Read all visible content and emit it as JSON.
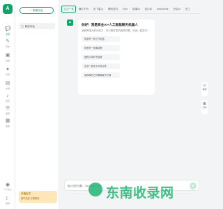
{
  "brand": {
    "logo_text": "A"
  },
  "rail": {
    "items": [
      {
        "icon": "chat-icon",
        "glyph": "💬",
        "label": "对话"
      },
      {
        "icon": "pen-icon",
        "glyph": "✎",
        "label": "写作"
      },
      {
        "icon": "image-icon",
        "glyph": "▣",
        "label": "绘画"
      },
      {
        "icon": "bulb-icon",
        "glyph": "●",
        "label": "灵感"
      },
      {
        "icon": "doc-icon",
        "glyph": "▤",
        "label": "文档"
      },
      {
        "icon": "music-icon",
        "glyph": "♪",
        "label": "音乐"
      },
      {
        "icon": "list-icon",
        "glyph": "☰",
        "label": "发现"
      },
      {
        "icon": "grid-icon",
        "glyph": "▦",
        "label": "更多"
      }
    ],
    "bottom": [
      {
        "icon": "user-icon",
        "glyph": "◉",
        "label": "个人中心"
      },
      {
        "icon": "moon-icon",
        "glyph": "☾",
        "label": "夜间"
      }
    ]
  },
  "sidebar": {
    "new_button": "+ 新建对话",
    "conversation": "新的对话"
  },
  "vip": {
    "line1": "开通会员",
    "line2": "畅享高级 无限使用"
  },
  "tabs": [
    {
      "label": "文心一言",
      "active": true
    },
    {
      "label": "通义千问",
      "active": false
    },
    {
      "label": "讯飞星火",
      "active": false
    },
    {
      "label": "腾讯混元",
      "active": false
    },
    {
      "label": "Kimi",
      "active": false
    },
    {
      "label": "智谱AI",
      "active": false
    },
    {
      "label": "百川AI",
      "active": false
    },
    {
      "label": "DeepSeek",
      "active": false
    },
    {
      "label": "豆包AI",
      "active": false
    },
    {
      "label": "天工",
      "active": false
    }
  ],
  "chat": {
    "avatar": "AI",
    "title": "你好！我是商业AI+人工智能聊天机器人",
    "subtitle": "我拥有强大的AI能力，可以解答您的各种问题，欢迎一起探讨！",
    "suggestions": [
      "帮我写一篇工作总结",
      "帮我写一篇演讲稿",
      "推荐几本好书给我",
      "生成一篇关于AI的文章",
      "用简单的方式解释量子计算"
    ]
  },
  "composer": {
    "placeholder": "输入您的问题，Ctrl+Enter 发送"
  },
  "floats": [
    {
      "icon": "phone-icon",
      "glyph": "☏",
      "label": "客服"
    },
    {
      "icon": "qrcode-icon",
      "glyph": "▦",
      "label": "扫码"
    }
  ],
  "watermark": "东南收录网"
}
